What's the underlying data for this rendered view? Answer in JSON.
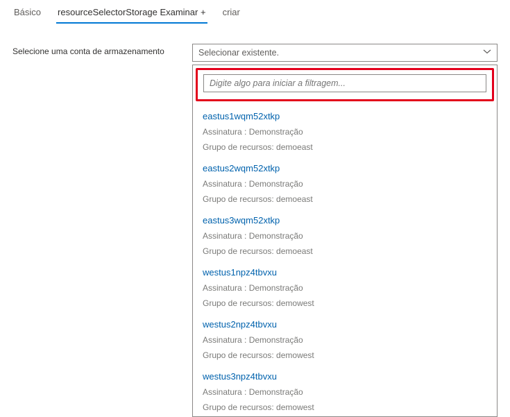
{
  "tabs": {
    "basic": "Básico",
    "storage": "resourceSelectorStorage Examinar +",
    "create": "criar"
  },
  "form": {
    "label": "Selecione uma conta de armazenamento"
  },
  "select": {
    "placeholder": "Selecionar existente."
  },
  "filter": {
    "placeholder": "Digite algo para iniciar a filtragem..."
  },
  "meta_labels": {
    "subscription_prefix": "Assinatura : ",
    "resourcegroup_prefix": "Grupo de recursos: "
  },
  "items": [
    {
      "name": "eastus1wqm52xtkp",
      "subscription": "Demonstração",
      "resourceGroup": "demoeast"
    },
    {
      "name": "eastus2wqm52xtkp",
      "subscription": "Demonstração",
      "resourceGroup": "demoeast"
    },
    {
      "name": "eastus3wqm52xtkp",
      "subscription": "Demonstração",
      "resourceGroup": "demoeast"
    },
    {
      "name": "westus1npz4tbvxu",
      "subscription": "Demonstração",
      "resourceGroup": "demowest"
    },
    {
      "name": "westus2npz4tbvxu",
      "subscription": "Demonstração",
      "resourceGroup": "demowest"
    },
    {
      "name": "westus3npz4tbvxu",
      "subscription": "Demonstração",
      "resourceGroup": "demowest"
    }
  ]
}
